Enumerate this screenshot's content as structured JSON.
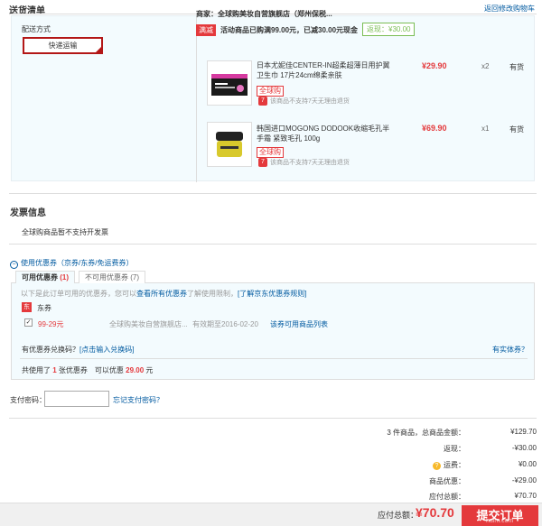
{
  "header": {
    "title": "送货清单",
    "return_link": "返回修改购物车"
  },
  "shipping": {
    "method_label": "配送方式",
    "method_button": "快递运输",
    "store": "商家：全球购美妆自营旗舰店（郑州保税...",
    "promo_tag": "满减",
    "promo_text": "活动商品已购满99.00元，已减30.00元现金",
    "promo_saved": "返现：¥30.00",
    "items": [
      {
        "name": "日本尤妮佳CENTER-IN超柔超薄日用护翼卫生巾 17片24cm绵柔亲肤",
        "badge": "全球购",
        "note": "该商品不支持7天无理由退货",
        "price": "¥29.90",
        "qty": "x2",
        "stock": "有货",
        "image_icon": "pad-package-image"
      },
      {
        "name": "韩国进口MOGONG DODOOK收缩毛孔半手霜 紧致毛孔 100g",
        "badge": "全球购",
        "note": "该商品不支持7天无理由退货",
        "price": "¥69.90",
        "qty": "x1",
        "stock": "有货",
        "image_icon": "cream-jar-image"
      }
    ]
  },
  "invoice": {
    "title": "发票信息",
    "text": "全球购商品暂不支持开发票"
  },
  "coupons": {
    "toggle_label": "使用优惠券（京券/东券/免运费券）",
    "tab_available": "可用优惠券",
    "tab_available_count": "(1)",
    "tab_unavailable": "不可用优惠券 (7)",
    "hint_prefix": "以下是此订单可用的优惠券，您可以",
    "hint_link1": "查看所有优惠券",
    "hint_middle": "了解使用限制，",
    "hint_link2": "[了解京东优惠券规则]",
    "type_logo": "东",
    "type_label": "东券",
    "coupon_amount": "99-29元",
    "coupon_store": "全球购美妆自营旗舰店...",
    "coupon_expiry": "有效期至2016-02-20",
    "coupon_products_link": "该券可用商品列表",
    "redeem_question": "有优惠券兑换码？",
    "redeem_link": "[点击输入兑换码]",
    "physical_link": "有实体券？",
    "summary_prefix": "共使用了",
    "summary_count": "1",
    "summary_mid": "张优惠券　可以优惠",
    "summary_amount": "29.00",
    "summary_suffix": "元"
  },
  "payment": {
    "password_label": "支付密码：",
    "password_value": "",
    "forgot_link": "忘记支付密码？"
  },
  "totals": {
    "rows": [
      {
        "label": "3 件商品，总商品金额：",
        "value": "¥129.70"
      },
      {
        "label": "返现：",
        "value": "-¥30.00"
      },
      {
        "label": "运费：",
        "value": "¥0.00"
      },
      {
        "label": "商品优惠：",
        "value": "-¥29.00"
      },
      {
        "label": "应付总额：",
        "value": "¥70.70"
      }
    ],
    "due_label": "应付总额：",
    "due_value": "¥70.70",
    "submit": "提交订单",
    "watermark": "huim.com"
  },
  "colors": {
    "accent": "#e4393c",
    "link": "#005aa0",
    "panel": "#f3fbfe",
    "green": "#7abd54"
  }
}
